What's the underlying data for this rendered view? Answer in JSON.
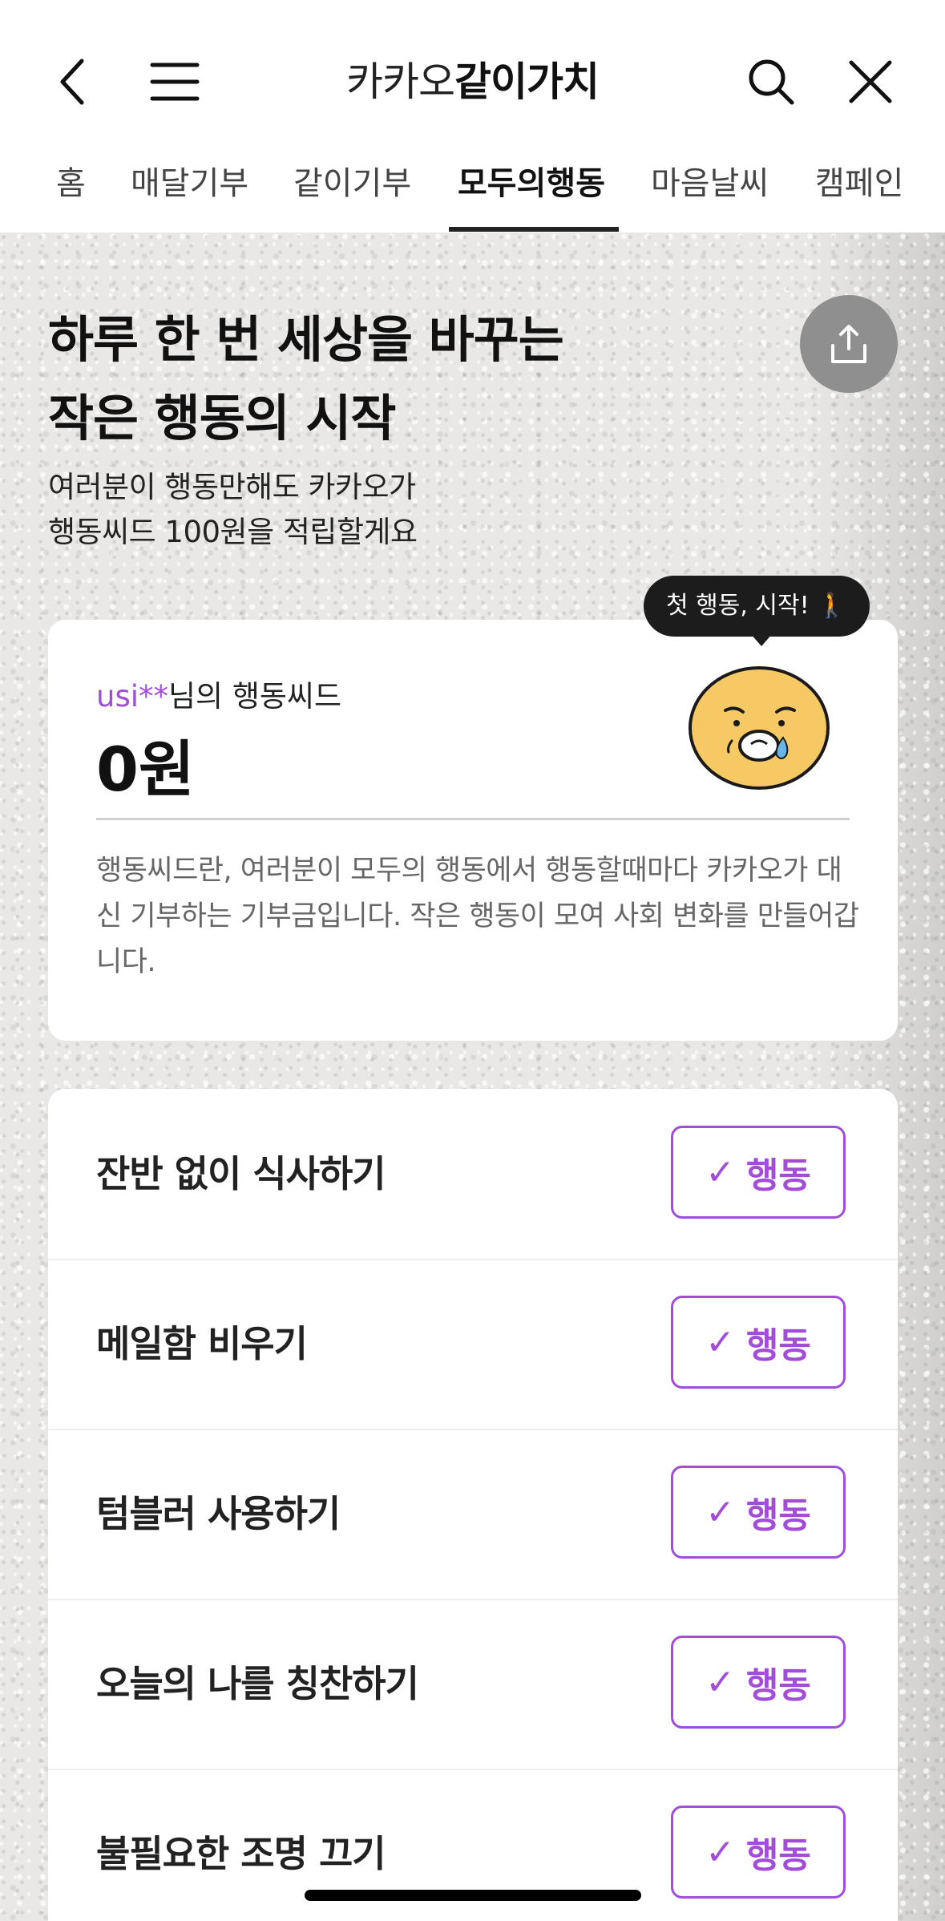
{
  "header": {
    "title_part1": "카카오",
    "title_part2": "같이가치",
    "icons": [
      "back-icon",
      "menu-icon",
      "search-icon",
      "close-icon"
    ]
  },
  "tabs": [
    "홈",
    "매달기부",
    "같이기부",
    "모두의행동",
    "마음날씨",
    "캠페인"
  ],
  "active_tab": "모두의행동",
  "hero": {
    "title_line1": "하루 한 번 세상을 바꾸는",
    "title_line2": "작은 행동의 시작",
    "desc_line1": "여러분이 행동만해도 카카오가",
    "desc_line2": "행동씨드 100원을 적립할게요"
  },
  "seed": {
    "tooltip": "첫 행동, 시작! 🚶",
    "username": "usi**",
    "label_suffix": "님의 행동씨드",
    "amount": "0원",
    "description": "행동씨드란, 여러분이 모두의 행동에서 행동할때마다 카카오가 대신 기부하는 기부금입니다. 작은 행동이 모여 사회 변화를 만들어갑니다."
  },
  "actions": {
    "button_label": "행동",
    "items": [
      "잔반 없이 식사하기",
      "메일함 비우기",
      "텀블러 사용하기",
      "오늘의 나를 칭찬하기",
      "불필요한 조명 끄기"
    ]
  },
  "colors": {
    "accent": "#a24dd8",
    "face_fill": "#f7c964"
  }
}
